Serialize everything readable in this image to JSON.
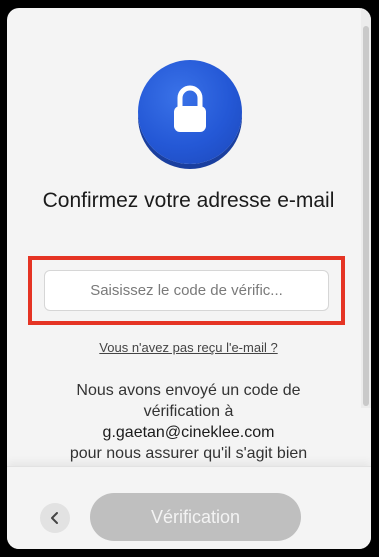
{
  "dialog": {
    "title": "Confirmez votre adresse e-mail",
    "code_input": {
      "placeholder": "Saisissez le code de vérific...",
      "value": ""
    },
    "resend_link": "Vous n'avez pas reçu l'e-mail ?",
    "message": {
      "intro": "Nous avons envoyé un code de vérification à",
      "email": "g.gaetan@cineklee.com",
      "outro": "pour nous assurer qu'il s'agit bien"
    }
  },
  "footer": {
    "back_icon": "chevron-left-icon",
    "verify_label": "Vérification"
  },
  "icons": {
    "badge": "lock-icon"
  },
  "colors": {
    "accent_blue": "#2458d6",
    "highlight_red": "#e53424",
    "disabled_button": "#bfbfbf"
  }
}
